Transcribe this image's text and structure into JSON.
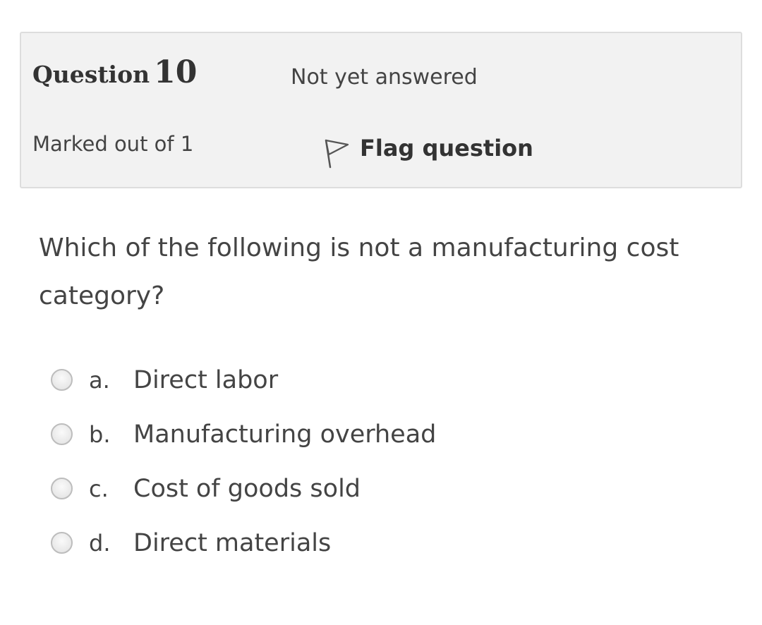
{
  "info": {
    "question_label": "Question",
    "question_number": "10",
    "state": "Not yet answered",
    "grade": "Marked out of 1",
    "flag_label": "Flag question",
    "flag_icon": "flag-icon"
  },
  "question": {
    "text": "Which of the following is not a manufacturing cost category?"
  },
  "answers": [
    {
      "letter": "a.",
      "text": "Direct labor",
      "selected": false
    },
    {
      "letter": "b.",
      "text": "Manufacturing overhead",
      "selected": false
    },
    {
      "letter": "c.",
      "text": "Cost of goods sold",
      "selected": false
    },
    {
      "letter": "d.",
      "text": "Direct materials",
      "selected": false
    }
  ]
}
